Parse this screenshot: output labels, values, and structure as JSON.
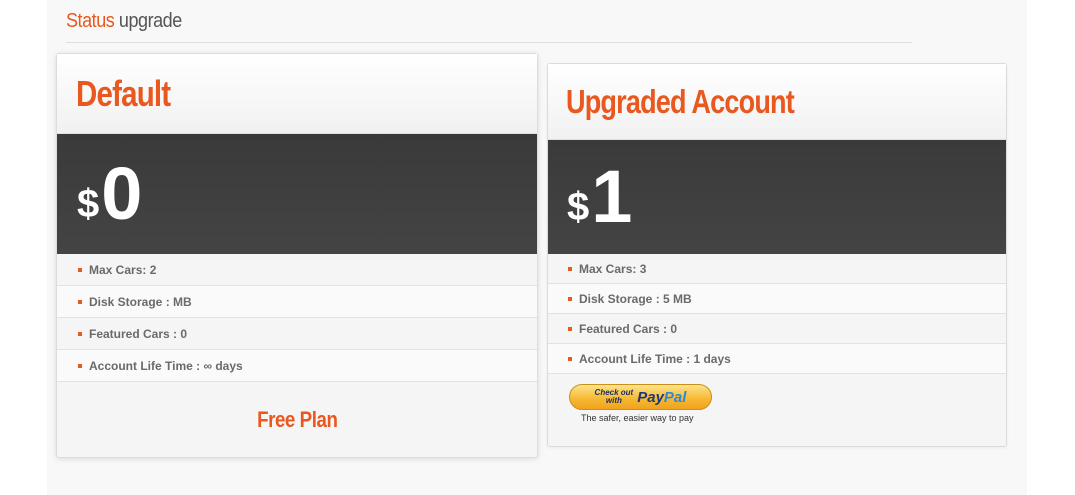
{
  "header": {
    "title_accent": "Status",
    "title_rest": "upgrade"
  },
  "plans": {
    "default": {
      "title": "Default",
      "currency": "$",
      "price": "0",
      "features": [
        "Max Cars: 2",
        "Disk Storage : MB",
        "Featured Cars : 0",
        "Account Life Time : ∞ days"
      ],
      "footer_label": "Free Plan"
    },
    "upgraded": {
      "title": "Upgraded Account",
      "currency": "$",
      "price": "1",
      "features": [
        "Max Cars: 3",
        "Disk Storage : 5 MB",
        "Featured Cars : 0",
        "Account Life Time : 1 days"
      ],
      "paypal": {
        "small_text": "Check out\nwith",
        "logo_part1": "Pay",
        "logo_part2": "Pal",
        "tagline": "The safer, easier way to pay"
      }
    }
  },
  "colors": {
    "accent": "#e8581f",
    "price_band": "#3d3d3d",
    "paypal_gold": "#f7b731"
  },
  "icons": {
    "feature_bullet": "square-bullet-icon"
  }
}
